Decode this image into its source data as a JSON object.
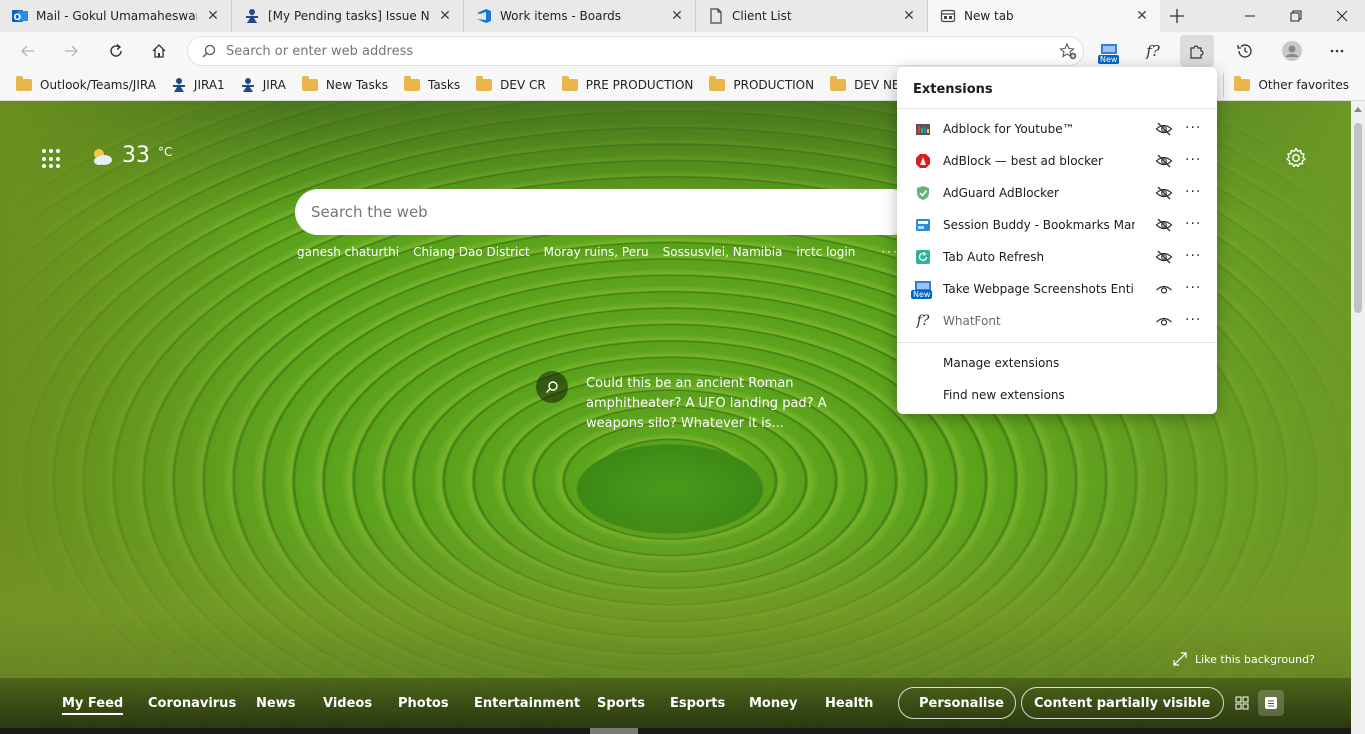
{
  "tabs": [
    {
      "title": "Mail - Gokul Umamaheswaran",
      "icon": "outlook-icon",
      "active": false
    },
    {
      "title": "[My Pending tasks] Issue Navig",
      "icon": "jira-icon",
      "active": false
    },
    {
      "title": "Work items - Boards",
      "icon": "azure-devops-icon",
      "active": false
    },
    {
      "title": "Client List",
      "icon": "page-icon",
      "active": false
    },
    {
      "title": "New tab",
      "icon": "newtab-icon",
      "active": true
    }
  ],
  "toolbar": {
    "address_placeholder": "Search or enter web address",
    "new_badge": "New",
    "whatfont_label": "f?"
  },
  "favorites": {
    "items": [
      {
        "label": "Outlook/Teams/JIRA",
        "type": "folder"
      },
      {
        "label": "JIRA1",
        "type": "jira"
      },
      {
        "label": "JIRA",
        "type": "jira"
      },
      {
        "label": "New Tasks",
        "type": "folder"
      },
      {
        "label": "Tasks",
        "type": "folder"
      },
      {
        "label": "DEV CR",
        "type": "folder"
      },
      {
        "label": "PRE PRODUCTION",
        "type": "folder"
      },
      {
        "label": "PRODUCTION",
        "type": "folder"
      },
      {
        "label": "DEV NEW",
        "type": "folder"
      }
    ],
    "other_label": "Other favorites"
  },
  "newtab": {
    "temperature": "33",
    "temperature_unit": "°C",
    "search_placeholder": "Search the web",
    "trending": [
      "ganesh chaturthi",
      "Chiang Dao District",
      "Moray ruins, Peru",
      "Sossusvlei, Namibia",
      "irctc login"
    ],
    "more": "···",
    "caption": "Could this be an ancient Roman amphitheater? A UFO landing pad? A weapons silo? Whatever it is...",
    "like_background": "Like this background?",
    "feed_nav": [
      "My Feed",
      "Coronavirus",
      "News",
      "Videos",
      "Photos",
      "Entertainment",
      "Sports",
      "Esports",
      "Money",
      "Health"
    ],
    "personalise": "Personalise",
    "content_visibility": "Content partially visible"
  },
  "extensions": {
    "title": "Extensions",
    "items": [
      {
        "name": "Adblock for Youtube™",
        "visible": false
      },
      {
        "name": "AdBlock — best ad blocker",
        "visible": false
      },
      {
        "name": "AdGuard AdBlocker",
        "visible": false
      },
      {
        "name": "Session Buddy - Bookmarks Mana...",
        "visible": false
      },
      {
        "name": "Tab Auto Refresh",
        "visible": false
      },
      {
        "name": "Take Webpage Screenshots Entirel...",
        "visible": true,
        "badge": "New"
      },
      {
        "name": "WhatFont",
        "visible": true,
        "gray": true,
        "icon_text": "f?"
      }
    ],
    "manage": "Manage extensions",
    "find": "Find new extensions"
  },
  "colors": {
    "accent": "#0067c0",
    "folder": "#e8b64a"
  }
}
